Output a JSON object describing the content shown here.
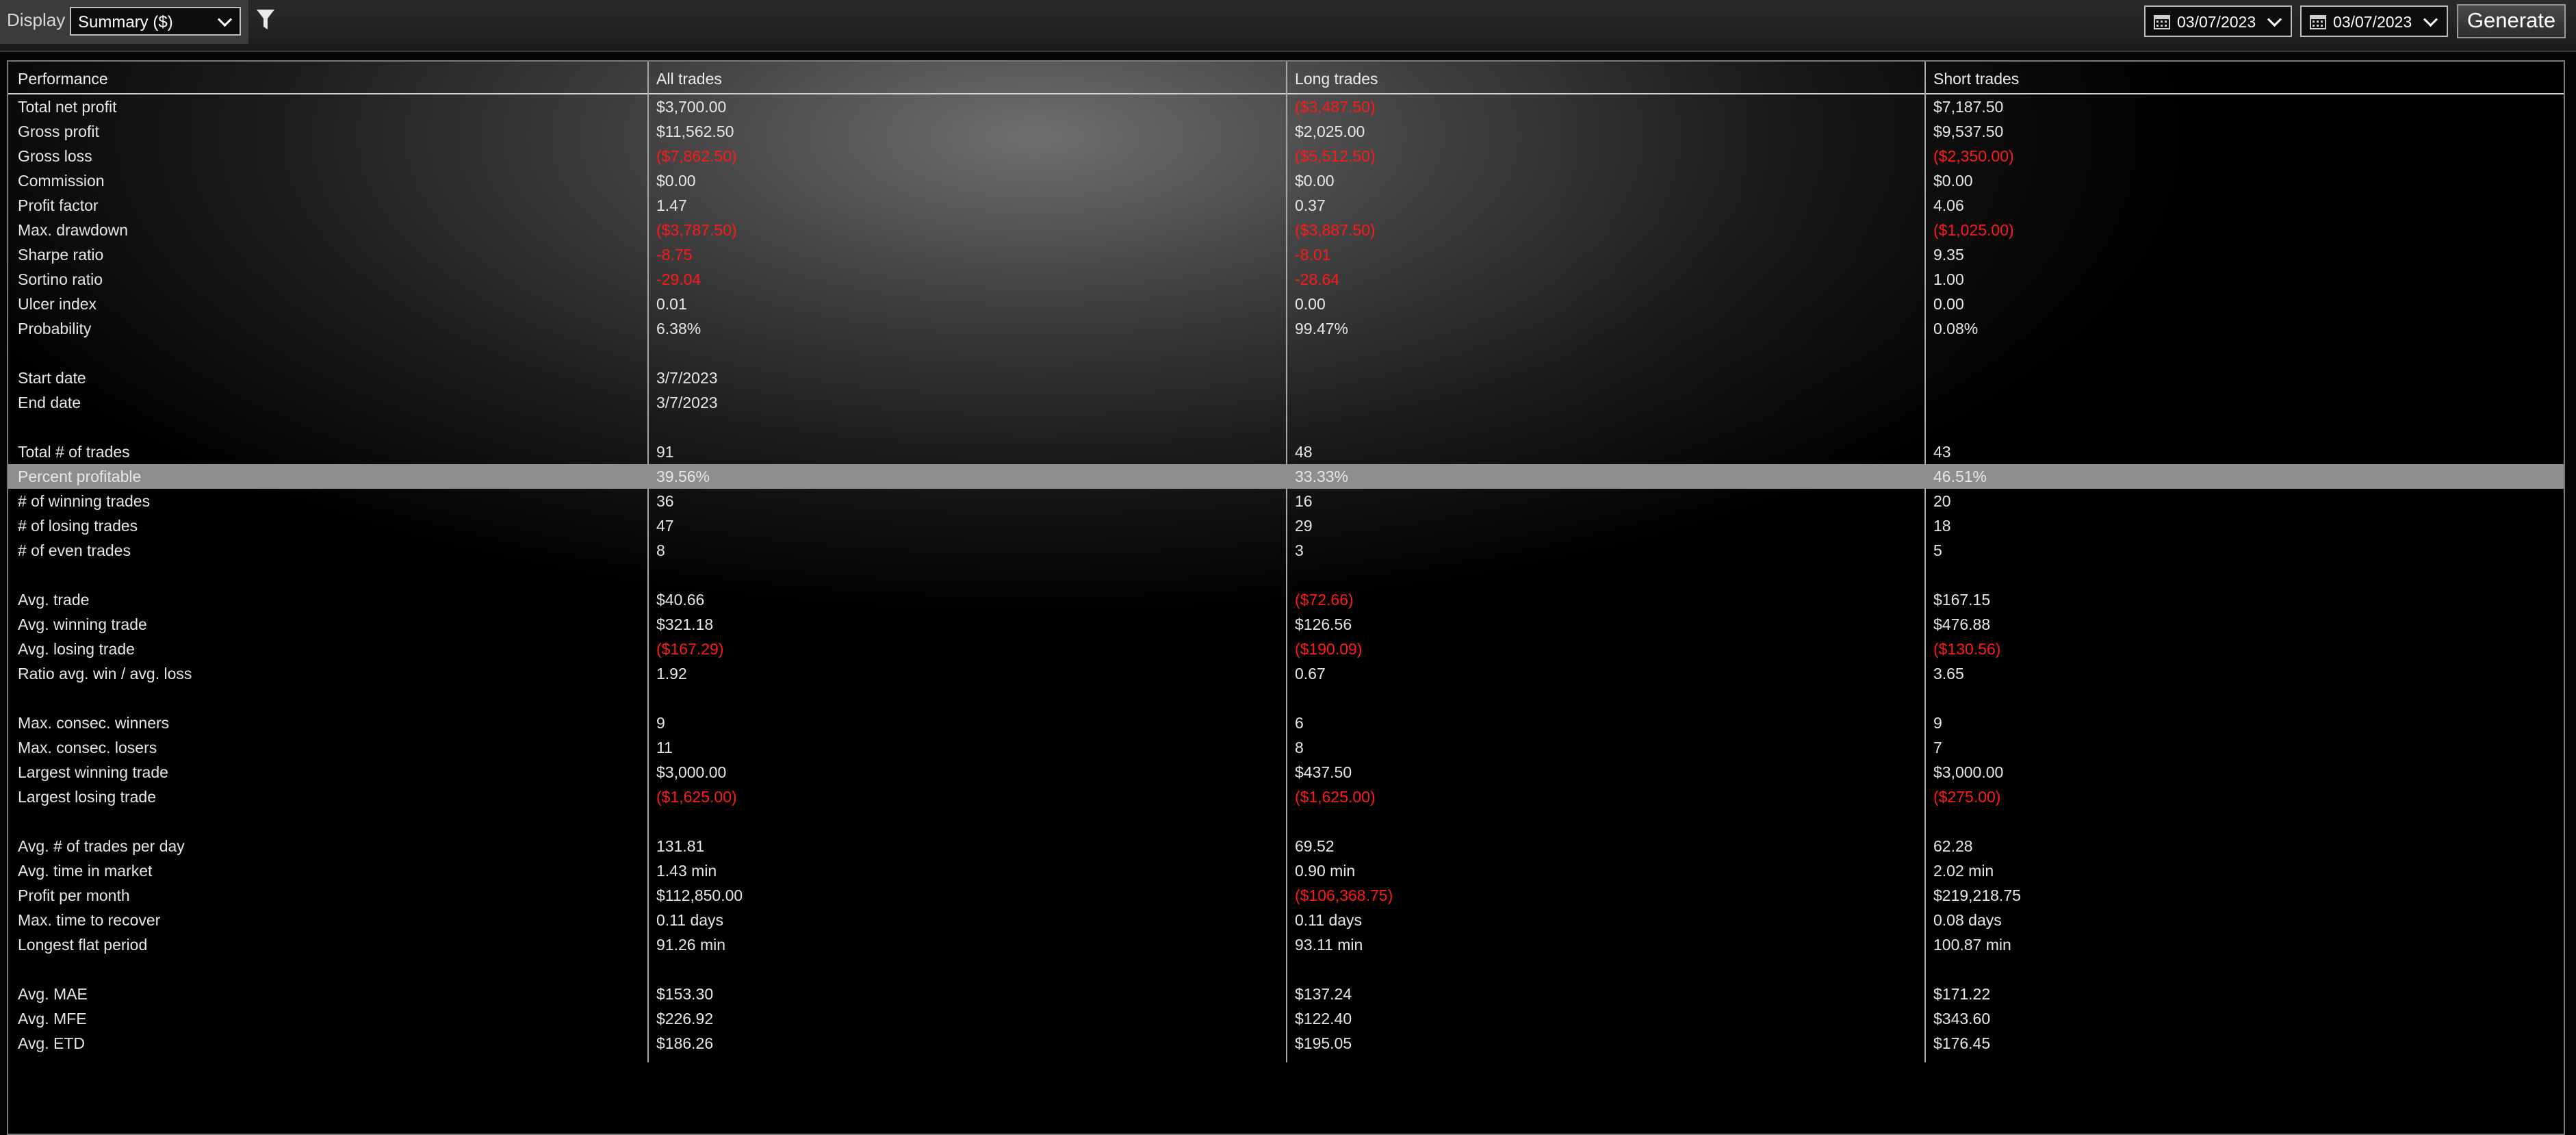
{
  "toolbar": {
    "display_label": "Display",
    "display_value": "Summary ($)",
    "date_from": "03/07/2023",
    "date_to": "03/07/2023",
    "generate_label": "Generate"
  },
  "columns": [
    "Performance",
    "All trades",
    "Long trades",
    "Short trades"
  ],
  "negative_color": "#ff1a1a",
  "selected_row": "Percent profitable",
  "rows": [
    {
      "label": "Total net profit",
      "all": "$3,700.00",
      "long": "($3,487.50)",
      "short": "$7,187.50"
    },
    {
      "label": "Gross profit",
      "all": "$11,562.50",
      "long": "$2,025.00",
      "short": "$9,537.50"
    },
    {
      "label": "Gross loss",
      "all": "($7,862.50)",
      "long": "($5,512.50)",
      "short": "($2,350.00)"
    },
    {
      "label": "Commission",
      "all": "$0.00",
      "long": "$0.00",
      "short": "$0.00"
    },
    {
      "label": "Profit factor",
      "all": "1.47",
      "long": "0.37",
      "short": "4.06"
    },
    {
      "label": "Max. drawdown",
      "all": "($3,787.50)",
      "long": "($3,887.50)",
      "short": "($1,025.00)"
    },
    {
      "label": "Sharpe ratio",
      "all": "-8.75",
      "long": "-8.01",
      "short": "9.35"
    },
    {
      "label": "Sortino ratio",
      "all": "-29.04",
      "long": "-28.64",
      "short": "1.00"
    },
    {
      "label": "Ulcer index",
      "all": "0.01",
      "long": "0.00",
      "short": "0.00"
    },
    {
      "label": "Probability",
      "all": "6.38%",
      "long": "99.47%",
      "short": "0.08%"
    },
    {
      "label": "",
      "all": "",
      "long": "",
      "short": ""
    },
    {
      "label": "Start date",
      "all": "3/7/2023",
      "long": "",
      "short": ""
    },
    {
      "label": "End date",
      "all": "3/7/2023",
      "long": "",
      "short": ""
    },
    {
      "label": "",
      "all": "",
      "long": "",
      "short": ""
    },
    {
      "label": "Total # of trades",
      "all": "91",
      "long": "48",
      "short": "43"
    },
    {
      "label": "Percent profitable",
      "all": "39.56%",
      "long": "33.33%",
      "short": "46.51%"
    },
    {
      "label": "# of winning trades",
      "all": "36",
      "long": "16",
      "short": "20"
    },
    {
      "label": "# of losing trades",
      "all": "47",
      "long": "29",
      "short": "18"
    },
    {
      "label": "# of even trades",
      "all": "8",
      "long": "3",
      "short": "5"
    },
    {
      "label": "",
      "all": "",
      "long": "",
      "short": ""
    },
    {
      "label": "Avg. trade",
      "all": "$40.66",
      "long": "($72.66)",
      "short": "$167.15"
    },
    {
      "label": "Avg. winning trade",
      "all": "$321.18",
      "long": "$126.56",
      "short": "$476.88"
    },
    {
      "label": "Avg. losing trade",
      "all": "($167.29)",
      "long": "($190.09)",
      "short": "($130.56)"
    },
    {
      "label": "Ratio avg. win / avg. loss",
      "all": "1.92",
      "long": "0.67",
      "short": "3.65"
    },
    {
      "label": "",
      "all": "",
      "long": "",
      "short": ""
    },
    {
      "label": "Max. consec. winners",
      "all": "9",
      "long": "6",
      "short": "9"
    },
    {
      "label": "Max. consec. losers",
      "all": "11",
      "long": "8",
      "short": "7"
    },
    {
      "label": "Largest winning trade",
      "all": "$3,000.00",
      "long": "$437.50",
      "short": "$3,000.00"
    },
    {
      "label": "Largest losing trade",
      "all": "($1,625.00)",
      "long": "($1,625.00)",
      "short": "($275.00)"
    },
    {
      "label": "",
      "all": "",
      "long": "",
      "short": ""
    },
    {
      "label": "Avg. # of trades per day",
      "all": "131.81",
      "long": "69.52",
      "short": "62.28"
    },
    {
      "label": "Avg. time in market",
      "all": "1.43 min",
      "long": "0.90 min",
      "short": "2.02 min"
    },
    {
      "label": "Profit per month",
      "all": "$112,850.00",
      "long": "($106,368.75)",
      "short": "$219,218.75"
    },
    {
      "label": "Max. time to recover",
      "all": "0.11 days",
      "long": "0.11 days",
      "short": "0.08 days"
    },
    {
      "label": "Longest flat period",
      "all": "91.26 min",
      "long": "93.11 min",
      "short": "100.87 min"
    },
    {
      "label": "",
      "all": "",
      "long": "",
      "short": ""
    },
    {
      "label": "Avg. MAE",
      "all": "$153.30",
      "long": "$137.24",
      "short": "$171.22"
    },
    {
      "label": "Avg. MFE",
      "all": "$226.92",
      "long": "$122.40",
      "short": "$343.60"
    },
    {
      "label": "Avg. ETD",
      "all": "$186.26",
      "long": "$195.05",
      "short": "$176.45"
    }
  ]
}
